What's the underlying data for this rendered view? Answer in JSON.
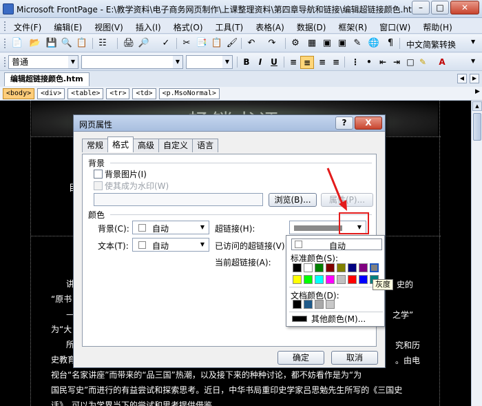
{
  "window": {
    "title": "Microsoft FrontPage - E:\\教学资料\\电子商务网页制作\\上课整理资料\\第四章导航和链接\\编辑超链接颜色.htm",
    "buttons": [
      "0",
      "1",
      "r"
    ]
  },
  "menu": [
    "文件(F)",
    "编辑(E)",
    "视图(V)",
    "插入(I)",
    "格式(O)",
    "工具(T)",
    "表格(A)",
    "数据(D)",
    "框架(R)",
    "窗口(W)",
    "帮助(H)"
  ],
  "toolbar": {
    "translate_label": "中文简繁转换"
  },
  "format_bar": {
    "style_value": "普通",
    "font_value": "",
    "size_value": "",
    "bold": "B",
    "italic": "I",
    "underline": "U",
    "font_color_glyph": "A"
  },
  "doc": {
    "tab_label": "编辑超链接颜色.htm",
    "tags": [
      "<body>",
      "<div>",
      "<table>",
      "<tr>",
      "<td>",
      "<p.MsoNormal>"
    ]
  },
  "page": {
    "banner_text": "畅销书评",
    "side_fragments": [
      "目",
      "史的",
      "之学”"
    ],
    "lines": [
      "讲",
      "“原书",
      "——",
      "为“大",
      "所",
      "史教育",
      "视台“名家讲座”而带来的“品三国”热潮，以及接下来的种种讨论，都不妨看作是为“为",
      "国民写史”而进行的有益尝试和探索思考。近日，中华书局重印史学家吕思勉先生所写的《三国史",
      "话》，可以为学界当下的尝试和思考提供借鉴。"
    ],
    "right_fragments": [
      "究和历",
      "。由电"
    ]
  },
  "dialog": {
    "title": "网页属性",
    "help_glyph": "?",
    "close_glyph": "X",
    "tabs": [
      "常规",
      "格式",
      "高级",
      "自定义",
      "语言"
    ],
    "active_tab": "格式",
    "background_group": "背景",
    "background_image_label": "背景图片(I)",
    "watermark_label": "使其成为水印(W)",
    "browse_label": "浏览(B)...",
    "properties_label": "属性(P)...",
    "color_group": "颜色",
    "bg_label": "背景(C):",
    "bg_value": "自动",
    "text_label": "文本(T):",
    "text_value": "自动",
    "hyperlink_label": "超链接(H):",
    "visited_label": "已访问的超链接(V):",
    "active_link_label": "当前超链接(A):",
    "ok_label": "确定",
    "cancel_label": "取消"
  },
  "color_popup": {
    "auto_label": "自动",
    "standard_label": "标准颜色(S):",
    "standard_colors": [
      "#000000",
      "#ffffff",
      "#008000",
      "#800000",
      "#808000",
      "#000080",
      "#800080",
      "#808080",
      "#ffff00",
      "#00ff00",
      "#00ffff",
      "#ff00ff",
      "#c0c0c0",
      "#ff0000",
      "#0000ff",
      "#008080"
    ],
    "document_label": "文档颜色(D):",
    "document_colors": [
      "#000000",
      "#1f5a8a",
      "#a9a9a9",
      "#c8c8c8"
    ],
    "more_label": "其他颜色(M)...",
    "tooltip": "灰度"
  },
  "accent": {
    "highlight": "#e31b1b",
    "selection": "#ffd67a"
  }
}
